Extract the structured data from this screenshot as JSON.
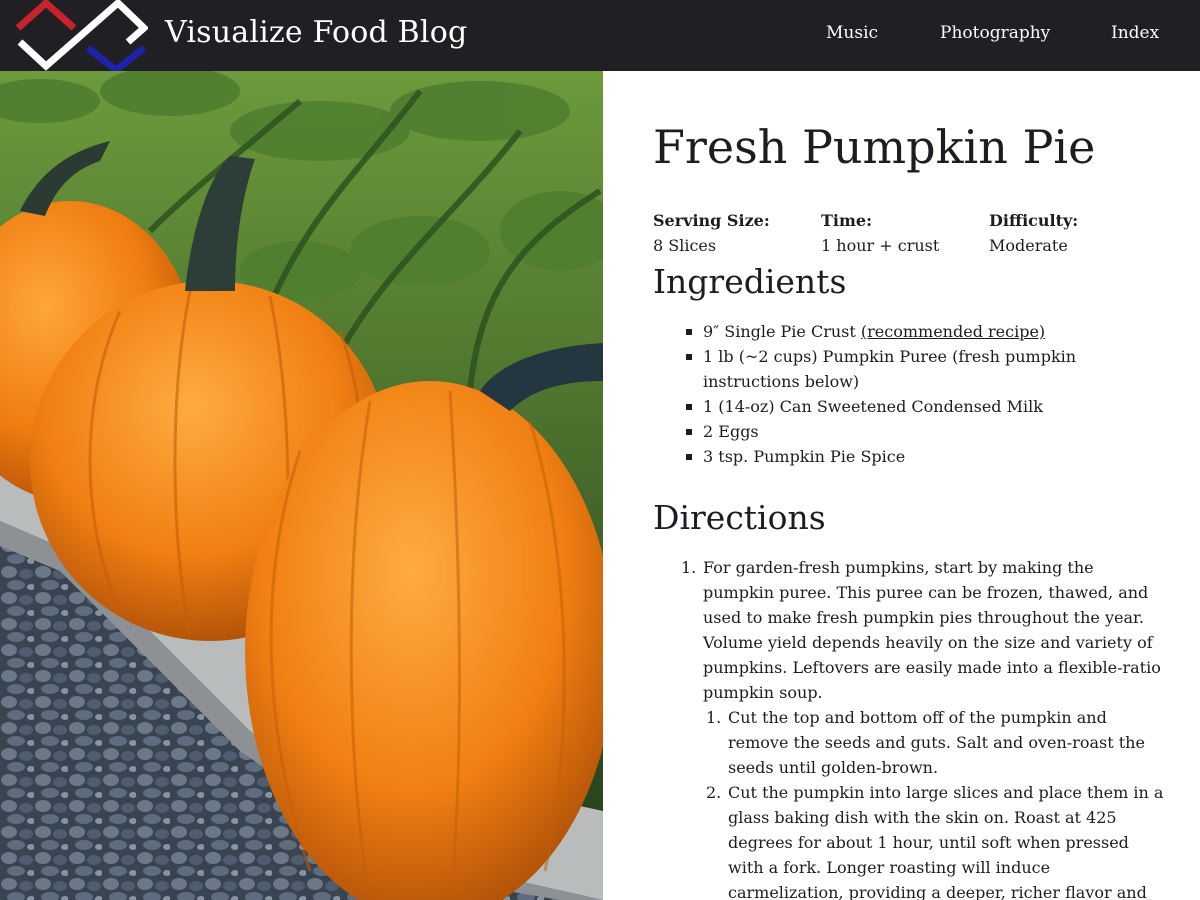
{
  "header": {
    "site_title": "Visualize Food Blog",
    "nav": [
      "Music",
      "Photography",
      "Index"
    ],
    "logo_colors": {
      "red": "#c8232c",
      "white": "#ffffff",
      "blue": "#1d22a8"
    },
    "background": "#1f1f24"
  },
  "hero_photo": {
    "icon": "pumpkins-photo"
  },
  "recipe": {
    "title": "Fresh Pumpkin Pie",
    "facts": [
      {
        "label": "Serving Size:",
        "value": "8 Slices"
      },
      {
        "label": "Time:",
        "value": "1 hour + crust"
      },
      {
        "label": "Difficulty:",
        "value": "Moderate"
      }
    ],
    "ingredients_heading": "Ingredients",
    "ingredients": [
      {
        "text": "9″ Single Pie Crust ",
        "link": "(recommended recipe)"
      },
      {
        "text": "1 lb (~2 cups) Pumpkin Puree (fresh pumpkin instructions below)"
      },
      {
        "text": "1 (14-oz) Can Sweetened Condensed Milk"
      },
      {
        "text": "2 Eggs"
      },
      {
        "text": "3 tsp. Pumpkin Pie Spice"
      }
    ],
    "directions_heading": "Directions",
    "directions": [
      {
        "number": "1.",
        "text": "For garden-fresh pumpkins, start by making the pumpkin puree. This puree can be frozen, thawed, and used to make fresh pumpkin pies throughout the year. Volume yield depends heavily on the size and variety of pumpkins. Leftovers are easily made into a flexible-ratio pumpkin soup.",
        "substeps": [
          {
            "number": "1.",
            "text": "Cut the top and bottom off of the pumpkin and remove the seeds and guts. Salt and oven-roast the seeds until golden-brown."
          },
          {
            "number": "2.",
            "text": "Cut the pumpkin into large slices and place them in a glass baking dish with the skin on. Roast at 425 degrees for about 1 hour, until soft when pressed with a fork. Longer roasting will induce carmelization, providing a deeper, richer flavor and"
          }
        ]
      }
    ]
  }
}
